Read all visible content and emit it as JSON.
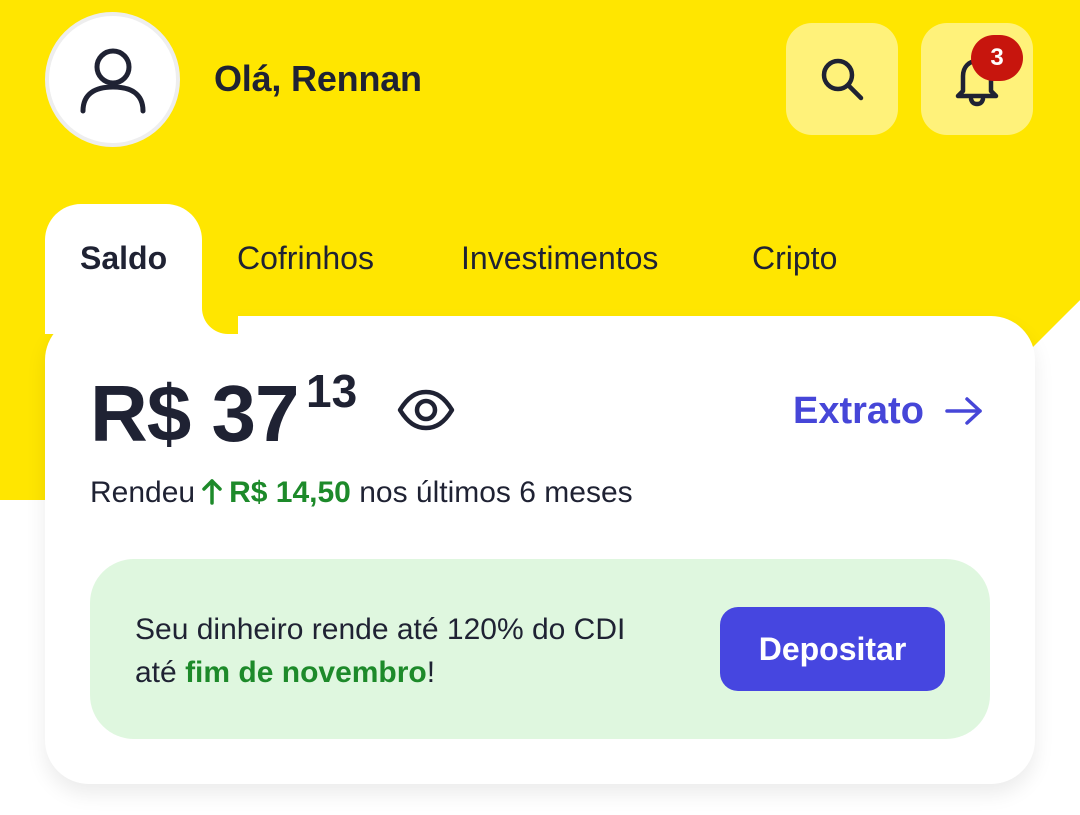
{
  "header": {
    "greeting": "Olá, Rennan",
    "notifications_count": "3",
    "avatar_icon": "user-icon",
    "search_icon": "search-icon",
    "bell_icon": "bell-icon"
  },
  "tabs": [
    {
      "label": "Saldo",
      "active": true
    },
    {
      "label": "Cofrinhos",
      "active": false
    },
    {
      "label": "Investimentos",
      "active": false
    },
    {
      "label": "Cripto",
      "active": false
    }
  ],
  "balance": {
    "currency_amount": "R$ 37",
    "cents": "13",
    "statement_label": "Extrato",
    "earned_prefix": "Rendeu",
    "earned_value": "R$ 14,50",
    "earned_suffix": "nos últimos 6 meses"
  },
  "promo": {
    "line1": "Seu dinheiro rende até 120% do CDI",
    "line2_prefix": "até",
    "line2_highlight": "fim de novembro",
    "line2_suffix": "!",
    "button_label": "Depositar"
  },
  "colors": {
    "brand_yellow": "#ffe600",
    "accent_blue": "#4646d8",
    "positive_green": "#1d8a2a",
    "badge_red": "#c7150d",
    "promo_bg": "#dff7df"
  }
}
